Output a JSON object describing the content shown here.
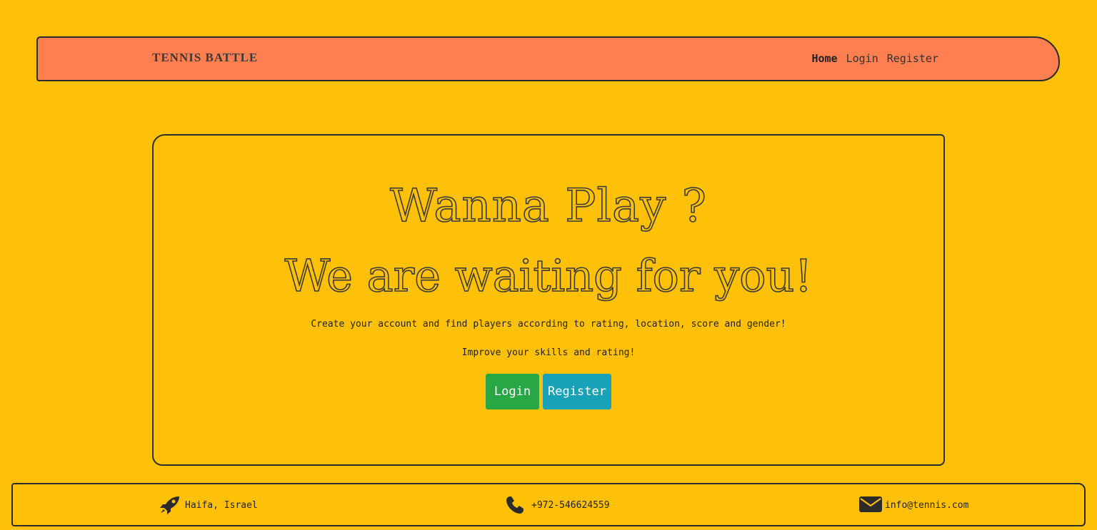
{
  "navbar": {
    "brand": "TENNIS BATTLE",
    "links": [
      "Home",
      "Login",
      "Register"
    ],
    "bg_color": "#FF7F50"
  },
  "hero": {
    "headline_1": "Wanna Play ?",
    "headline_2": "We are waiting for you!",
    "text_1": "Create your account and find players according to rating, location, score and gender!",
    "text_2": "Improve your skills and rating!",
    "login_button": "Login",
    "register_button": "Register",
    "login_color": "#28A745",
    "register_color": "#17A2B8"
  },
  "footer": {
    "location": "Haifa, Israel",
    "location_icon": "rocket-icon",
    "phone": "+972-546624559",
    "phone_icon": "phone-icon",
    "email": "info@tennis.com",
    "email_icon": "envelope-icon"
  },
  "page": {
    "bg_color": "#FFC107"
  }
}
